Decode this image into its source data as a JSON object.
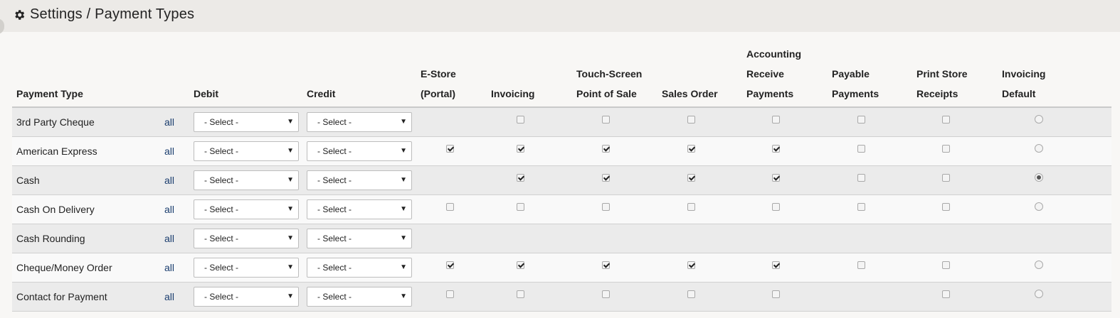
{
  "header": {
    "title": "Settings / Payment Types",
    "icon": "gear-icon"
  },
  "columns": {
    "payment_type": "Payment Type",
    "debit": "Debit",
    "credit": "Credit",
    "estore": [
      "E-Store",
      "(Portal)"
    ],
    "invoicing": "Invoicing",
    "touchscreen": [
      "Touch-Screen",
      "Point of Sale"
    ],
    "sales_order": "Sales Order",
    "accounting": [
      "Accounting",
      "Receive",
      "Payments"
    ],
    "payable": [
      "Payable",
      "Payments"
    ],
    "print_store": [
      "Print Store",
      "Receipts"
    ],
    "invoicing_default": [
      "Invoicing",
      "Default"
    ]
  },
  "select_placeholder": "- Select -",
  "rows": [
    {
      "name": "3rd Party Cheque",
      "scope": "all",
      "debit": "- Select -",
      "credit": "- Select -",
      "estore": null,
      "invoicing": false,
      "touchscreen": false,
      "sales_order": false,
      "accounting": false,
      "payable": false,
      "print_store": false,
      "default": false
    },
    {
      "name": "American Express",
      "scope": "all",
      "debit": "- Select -",
      "credit": "- Select -",
      "estore": true,
      "invoicing": true,
      "touchscreen": true,
      "sales_order": true,
      "accounting": true,
      "payable": false,
      "print_store": false,
      "default": false
    },
    {
      "name": "Cash",
      "scope": "all",
      "debit": "- Select -",
      "credit": "- Select -",
      "estore": null,
      "invoicing": true,
      "touchscreen": true,
      "sales_order": true,
      "accounting": true,
      "payable": false,
      "print_store": false,
      "default": true
    },
    {
      "name": "Cash On Delivery",
      "scope": "all",
      "debit": "- Select -",
      "credit": "- Select -",
      "estore": false,
      "invoicing": false,
      "touchscreen": false,
      "sales_order": false,
      "accounting": false,
      "payable": false,
      "print_store": false,
      "default": false
    },
    {
      "name": "Cash Rounding",
      "scope": "all",
      "debit": "- Select -",
      "credit": "- Select -",
      "estore": null,
      "invoicing": null,
      "touchscreen": null,
      "sales_order": null,
      "accounting": null,
      "payable": null,
      "print_store": null,
      "default": null
    },
    {
      "name": "Cheque/Money Order",
      "scope": "all",
      "debit": "- Select -",
      "credit": "- Select -",
      "estore": true,
      "invoicing": true,
      "touchscreen": true,
      "sales_order": true,
      "accounting": true,
      "payable": false,
      "print_store": false,
      "default": false
    },
    {
      "name": "Contact for Payment",
      "scope": "all",
      "debit": "- Select -",
      "credit": "- Select -",
      "estore": false,
      "invoicing": false,
      "touchscreen": false,
      "sales_order": false,
      "accounting": false,
      "payable": null,
      "print_store": false,
      "default": false
    }
  ]
}
